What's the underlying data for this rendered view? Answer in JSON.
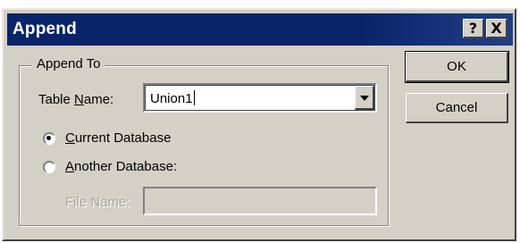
{
  "window": {
    "title": "Append",
    "help_label": "?",
    "close_label": "X"
  },
  "group": {
    "legend": "Append To"
  },
  "table_name": {
    "label": "Table Name:",
    "value": "Union1"
  },
  "radios": {
    "current_label": "Current Database",
    "another_label": "Another Database:",
    "selected": "current"
  },
  "file_name": {
    "label": "File Name:",
    "value": ""
  },
  "buttons": {
    "ok": "OK",
    "cancel": "Cancel"
  },
  "colors": {
    "titlebar": "#0a246a",
    "dialog_face": "#d4d0c8",
    "disabled_text": "#a7a49d"
  }
}
